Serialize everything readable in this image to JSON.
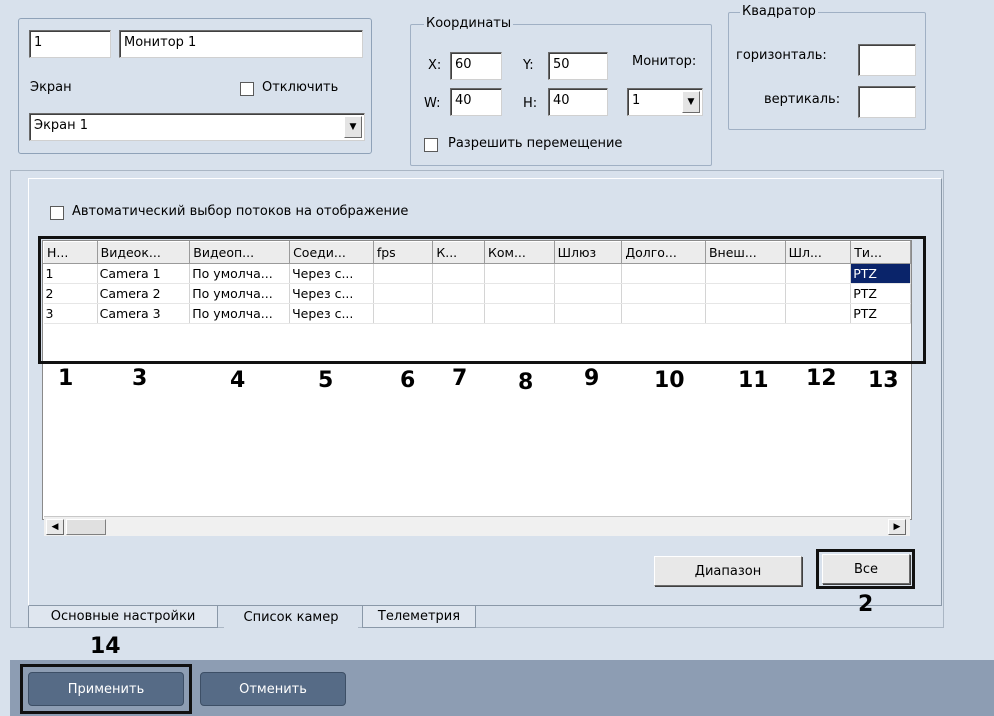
{
  "monitor": {
    "id_value": "1",
    "name_value": "Монитор 1",
    "screen_label": "Экран",
    "disable_label": "Отключить",
    "screen_value": "Экран 1"
  },
  "coords": {
    "legend": "Координаты",
    "x_label": "X:",
    "x_value": "60",
    "y_label": "Y:",
    "y_value": "50",
    "w_label": "W:",
    "w_value": "40",
    "h_label": "H:",
    "h_value": "40",
    "monitor_label": "Монитор:",
    "monitor_value": "1",
    "allow_move_label": "Разрешить перемещение"
  },
  "quad": {
    "legend": "Квадратор",
    "horizontal_label": "горизонталь:",
    "vertical_label": "вертикаль:"
  },
  "cameras": {
    "auto_select_label": "Автоматический выбор потоков на отображение",
    "columns": [
      "Н...",
      "Видеок...",
      "Видеоп...",
      "Соеди...",
      "fps",
      "К...",
      "Ком...",
      "Шлюз",
      "Долго...",
      "Внеш...",
      "Шл...",
      "Ти..."
    ],
    "rows": [
      [
        "1",
        "Camera 1",
        "По умолча...",
        "Через с...",
        "",
        "",
        "",
        "",
        "",
        "",
        "",
        "PTZ"
      ],
      [
        "2",
        "Camera 2",
        "По умолча...",
        "Через с...",
        "",
        "",
        "",
        "",
        "",
        "",
        "",
        "PTZ"
      ],
      [
        "3",
        "Camera 3",
        "По умолча...",
        "Через с...",
        "",
        "",
        "",
        "",
        "",
        "",
        "",
        "PTZ"
      ]
    ],
    "range_button": "Диапазон",
    "all_button": "Все"
  },
  "callouts": [
    "1",
    "3",
    "4",
    "5",
    "6",
    "7",
    "8",
    "9",
    "10",
    "11",
    "12",
    "13",
    "2",
    "14"
  ],
  "tabs": [
    "Основные настройки",
    "Список камер",
    "Телеметрия"
  ],
  "footer": {
    "apply_button": "Применить",
    "cancel_button": "Отменить"
  }
}
